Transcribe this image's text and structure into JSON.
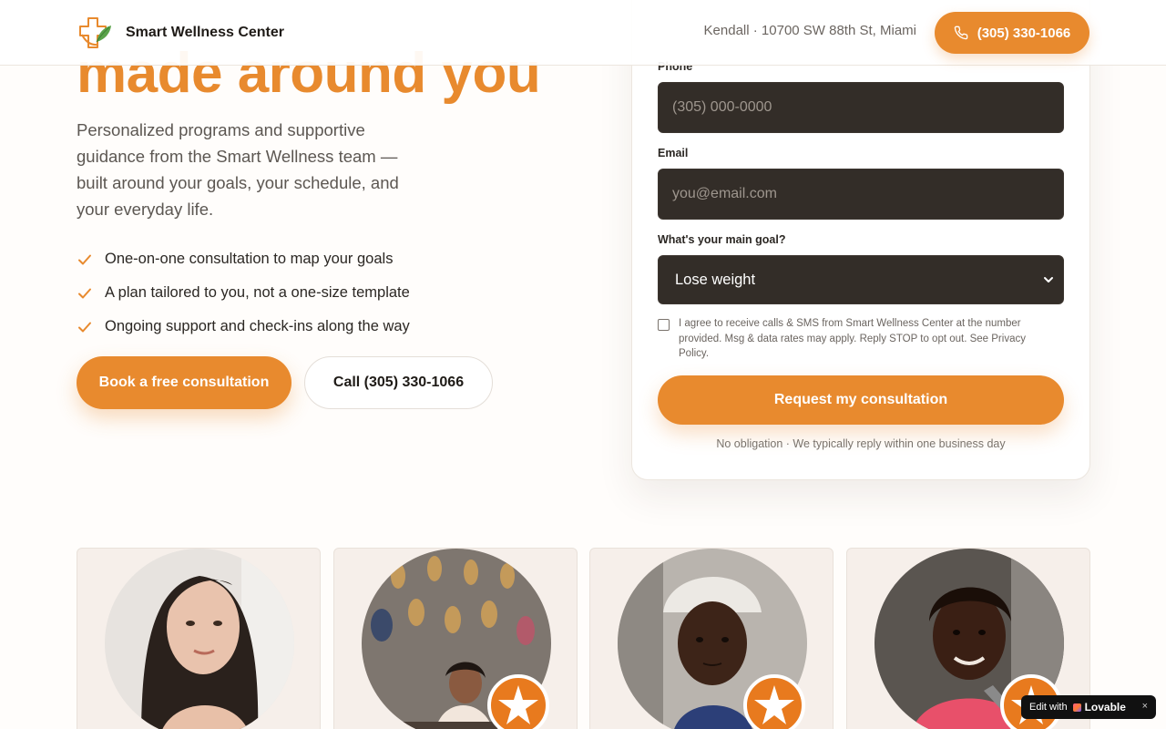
{
  "header": {
    "brand_name": "Smart Wellness Center",
    "location": "Kendall · 10700 SW 88th St, Miami",
    "phone": "(305) 330-1066"
  },
  "hero": {
    "title": "made around you",
    "subtitle": "Personalized programs and supportive guidance from the Smart Wellness team — built around your goals, your schedule, and your everyday life.",
    "checklist": [
      "One-on-one consultation to map your goals",
      "A plan tailored to you, not a one-size template",
      "Ongoing support and check-ins along the way"
    ],
    "primary_cta": "Book a free consultation",
    "secondary_cta": "Call (305) 330-1066"
  },
  "form": {
    "phone_label": "Phone",
    "phone_placeholder": "(305) 000-0000",
    "email_label": "Email",
    "email_placeholder": "you@email.com",
    "goal_label": "What's your main goal?",
    "goal_selected": "Lose weight",
    "consent_text": "I agree to receive calls & SMS from Smart Wellness Center at the number provided. Msg & data rates may apply. Reply STOP to opt out. See Privacy Policy.",
    "consent_checked": false,
    "submit_label": "Request my consultation",
    "note": "No obligation · We typically reply within one business day"
  },
  "testimonials": [
    {
      "photo": "avatar-photo-1",
      "has_badge": false
    },
    {
      "photo": "avatar-photo-2",
      "has_badge": true
    },
    {
      "photo": "avatar-photo-3",
      "has_badge": true
    },
    {
      "photo": "avatar-photo-4",
      "has_badge": true
    }
  ],
  "lovable_badge": {
    "prefix": "Edit with",
    "brand": "Lovable",
    "close": "×"
  },
  "colors": {
    "accent": "#e88a2e",
    "input_bg": "#332d28",
    "badge": "#e87a1e"
  }
}
